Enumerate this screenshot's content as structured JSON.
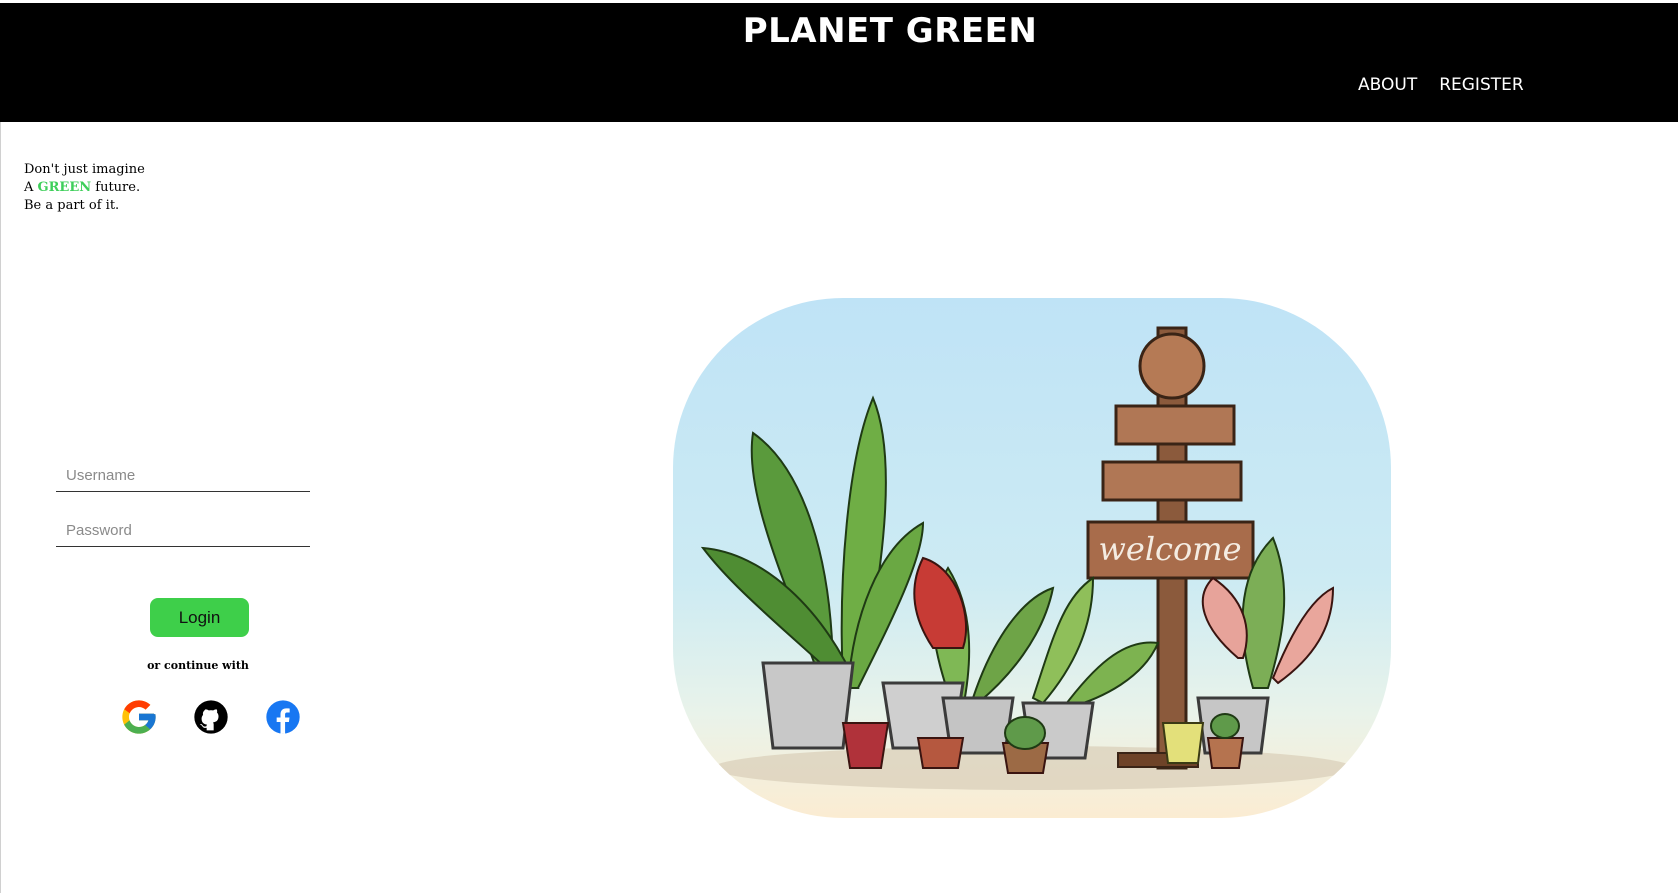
{
  "header": {
    "brand": "PLANET GREEN",
    "nav": [
      {
        "label": "ABOUT"
      },
      {
        "label": "REGISTER"
      }
    ]
  },
  "tagline": {
    "line1": "Don't just imagine",
    "line2_prefix": "A ",
    "line2_highlight": "GREEN",
    "line2_suffix": " future.",
    "line3": "Be a part of it."
  },
  "login": {
    "username_placeholder": "Username",
    "password_placeholder": "Password",
    "button_label": "Login",
    "continue_text": "or continue with"
  },
  "social": [
    {
      "name": "google",
      "icon": "google-icon"
    },
    {
      "name": "github",
      "icon": "github-icon"
    },
    {
      "name": "facebook",
      "icon": "facebook-icon"
    }
  ],
  "illustration": {
    "sign_text": "welcome"
  },
  "colors": {
    "header_bg": "#000000",
    "accent_green": "#3ecf5a",
    "button_green": "#3ecf4a",
    "facebook_blue": "#1877f2"
  }
}
